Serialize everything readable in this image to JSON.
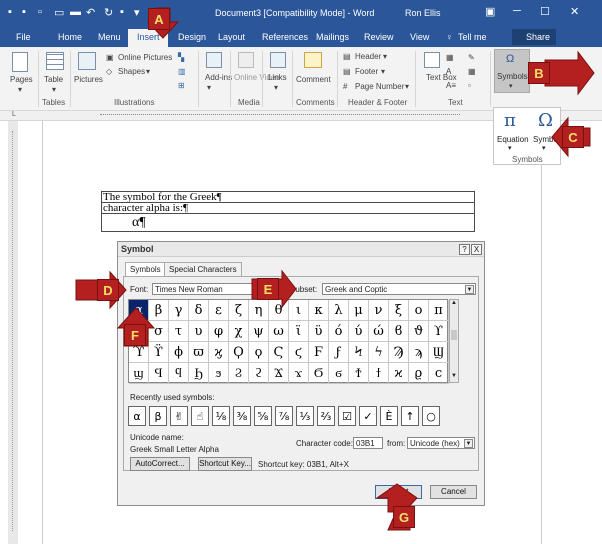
{
  "window": {
    "title": "Document3 [Compatibility Mode] - Word",
    "user": "Ron Ellis",
    "controls": [
      "ribbon-display",
      "minimize",
      "maximize",
      "close"
    ]
  },
  "tabs": [
    "File",
    "Home",
    "Menu",
    "Insert",
    "Design",
    "Layout",
    "References",
    "Mailings",
    "Review",
    "View",
    "Tell me"
  ],
  "share_label": "Share",
  "ribbon": {
    "pages": "Pages",
    "table": "Table",
    "pictures": "Pictures",
    "online_pictures": "Online Pictures",
    "shapes": "Shapes",
    "addins": "Add-ins",
    "online_video": "Online Video",
    "links": "Links",
    "comment": "Comment",
    "header": "Header",
    "footer": "Footer",
    "page_number": "Page Number",
    "text_box": "Text Box",
    "symbols": "Symbols",
    "groups": [
      "Tables",
      "Illustrations",
      "Media",
      "Comments",
      "Header & Footer",
      "Text"
    ]
  },
  "symbols_panel": {
    "equation": "Equation",
    "symbol": "Symbol",
    "group": "Symbols",
    "pi": "π",
    "omega": "Ω"
  },
  "document": {
    "line1": "The symbol for the Greek¶",
    "line2": "character alpha is:¶",
    "symbol": "α¶"
  },
  "dialog": {
    "title": "Symbol",
    "help": "?",
    "close": "X",
    "tab_symbols": "Symbols",
    "tab_special": "Special Characters",
    "font_label": "Font:",
    "font_value": "Times New Roman",
    "subset_label": "Subset:",
    "subset_value": "Greek and Coptic",
    "grid": [
      [
        "α",
        "β",
        "γ",
        "δ",
        "ε",
        "ζ",
        "η",
        "θ",
        "ι",
        "κ",
        "λ",
        "μ",
        "ν",
        "ξ",
        "ο",
        "π"
      ],
      [
        "ς",
        "σ",
        "τ",
        "υ",
        "φ",
        "χ",
        "ψ",
        "ω",
        "ϊ",
        "ϋ",
        "ό",
        "ύ",
        "ώ",
        "ϐ",
        "ϑ",
        "ϒ"
      ],
      [
        "ϓ",
        "ϔ",
        "ϕ",
        "ϖ",
        "ϗ",
        "Ϙ",
        "ϙ",
        "Ϛ",
        "ϛ",
        "Ϝ",
        "ϝ",
        "Ϟ",
        "ϟ",
        "Ϡ",
        "ϡ",
        "Ϣ"
      ],
      [
        "ϣ",
        "Ϥ",
        "ϥ",
        "Ϧ",
        "ϧ",
        "Ϩ",
        "ϩ",
        "Ϫ",
        "ϫ",
        "Ϭ",
        "ϭ",
        "Ϯ",
        "ϯ",
        "ϰ",
        "ϱ",
        "ϲ"
      ]
    ],
    "recent_label": "Recently used symbols:",
    "recent": [
      "α",
      "β",
      "✌",
      "☝",
      "⅛",
      "⅜",
      "⅝",
      "⅞",
      "⅓",
      "⅔",
      "☑",
      "✓",
      "È",
      "↑",
      "○"
    ],
    "unicode_name_label": "Unicode name:",
    "unicode_name": "Greek Small Letter Alpha",
    "char_code_label": "Character code:",
    "char_code": "03B1",
    "from_label": "from:",
    "from_value": "Unicode (hex)",
    "autocorrect": "AutoCorrect...",
    "shortcut_key": "Shortcut Key...",
    "shortcut_text": "Shortcut key: 03B1, Alt+X",
    "insert": "Insert",
    "cancel": "Cancel"
  },
  "callouts": [
    "A",
    "B",
    "C",
    "D",
    "E",
    "F",
    "G"
  ],
  "colors": {
    "word_blue": "#2b579a",
    "callout_red": "#b42020",
    "callout_text": "#f3e06a"
  }
}
